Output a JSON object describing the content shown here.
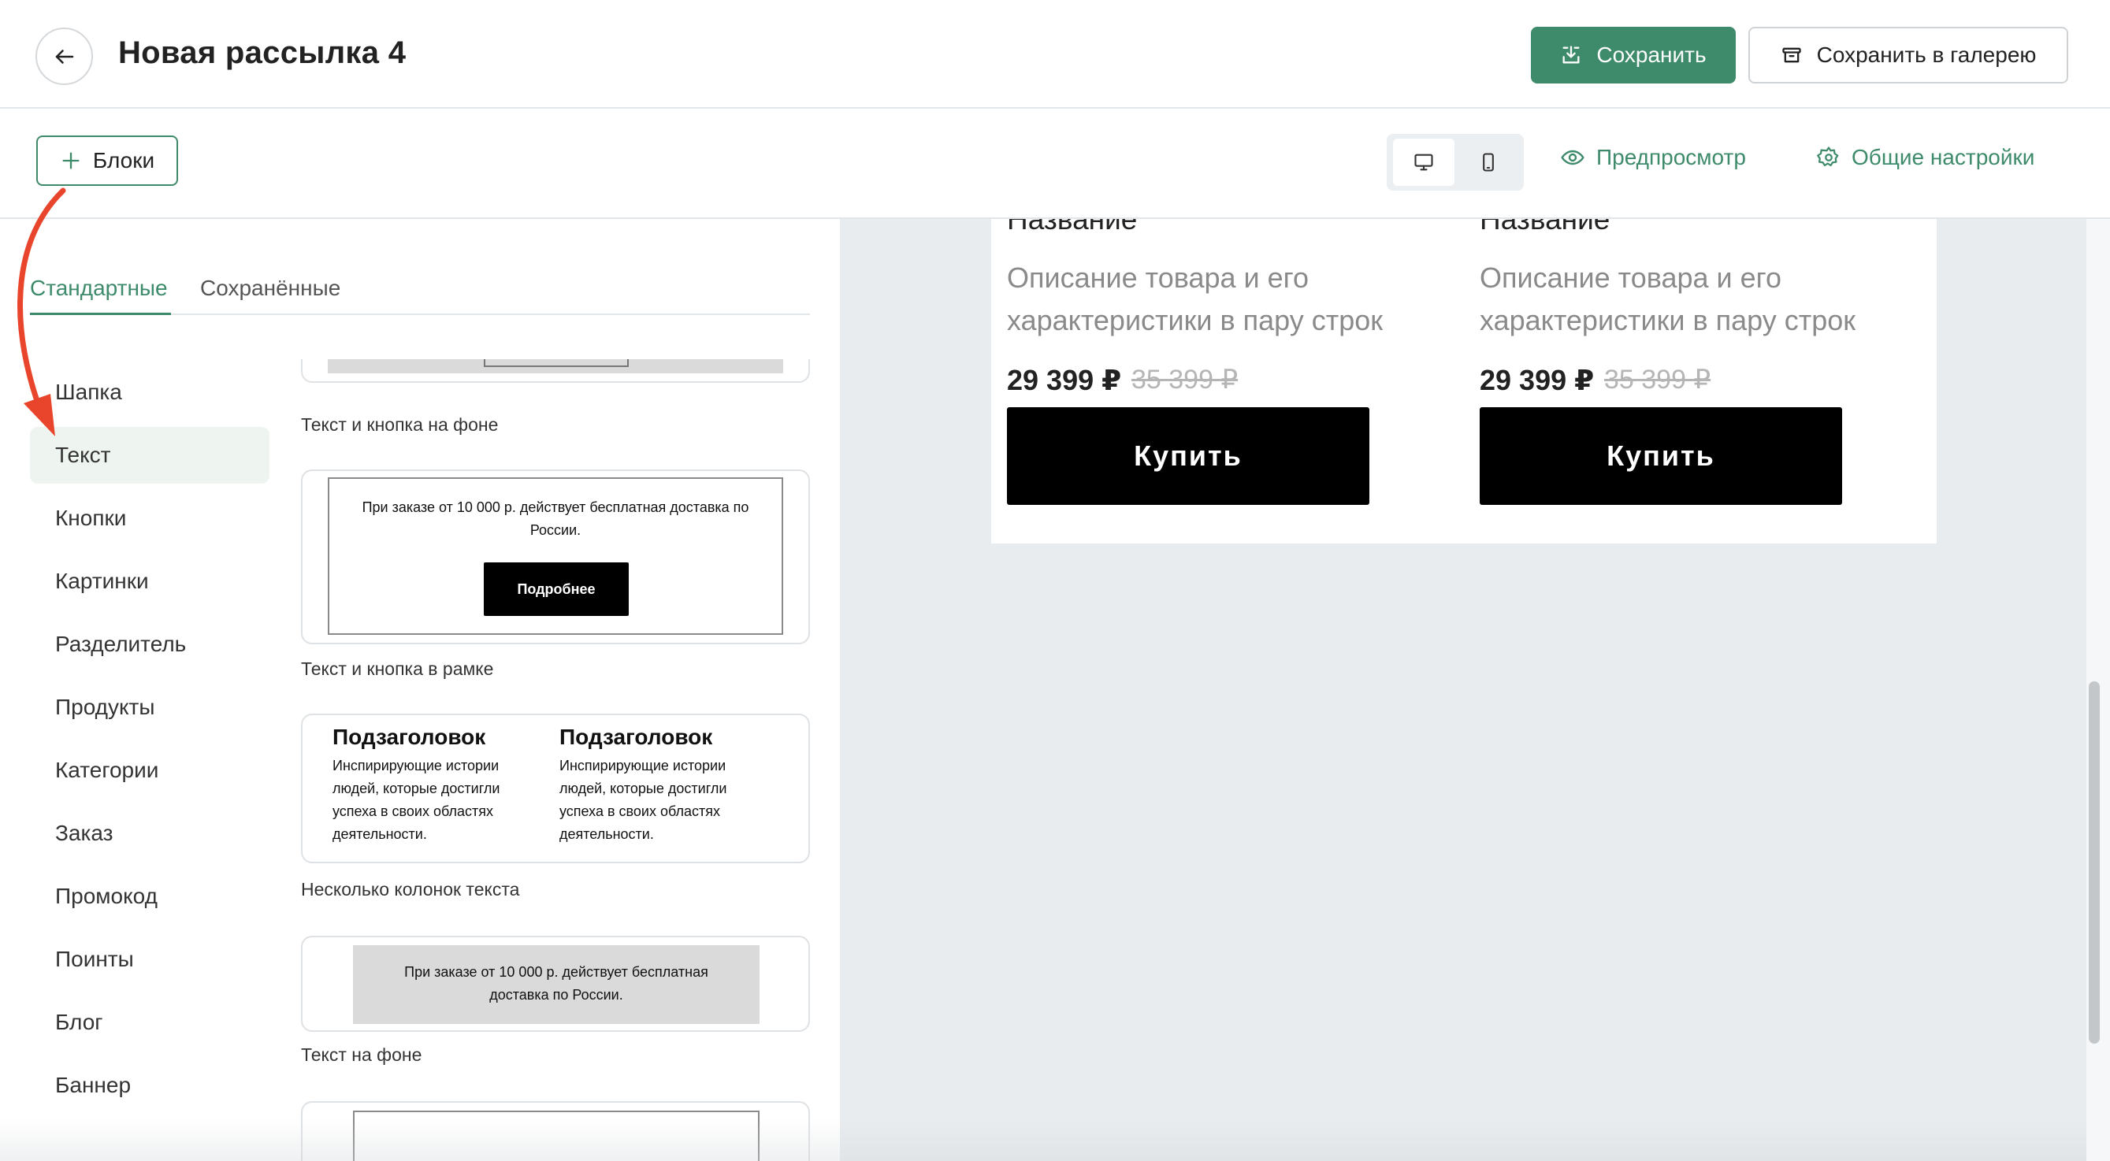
{
  "header": {
    "title": "Новая рассылка 4",
    "save_label": "Сохранить",
    "save_gallery_label": "Сохранить в галерею"
  },
  "toolbar": {
    "blocks_label": "Блоки",
    "preview_label": "Предпросмотр",
    "settings_label": "Общие настройки"
  },
  "tabs": {
    "standard": "Стандартные",
    "saved": "Сохранённые"
  },
  "categories": [
    "Шапка",
    "Текст",
    "Кнопки",
    "Картинки",
    "Разделитель",
    "Продукты",
    "Категории",
    "Заказ",
    "Промокод",
    "Поинты",
    "Блог",
    "Баннер"
  ],
  "active_category": "Текст",
  "blocks": {
    "text_button_bg_caption": "Текст и кнопка на фоне",
    "frame": {
      "text": "При заказе от 10 000 р. действует бесплатная доставка по России.",
      "button": "Подробнее",
      "caption": "Текст и кнопка в рамке"
    },
    "columns": {
      "col1_title": "Подзаголовок",
      "col1_text": "Инспирирующие истории людей, которые достигли успеха в своих областях деятельности.",
      "col2_title": "Подзаголовок",
      "col2_text": "Инспирирующие истории людей, которые достигли успеха в своих областях деятельности.",
      "caption": "Несколько колонок текста"
    },
    "text_bg": {
      "text": "При заказе от 10 000 р. действует бесплатная доставка по России.",
      "caption": "Текст на фоне"
    }
  },
  "products": [
    {
      "name": "Название",
      "description": "Описание товара и его характеристики в пару строк",
      "price": "29 399 ₽",
      "old_price": "35 399 ₽",
      "button": "Купить"
    },
    {
      "name": "Название",
      "description": "Описание товара и его характеристики в пару строк",
      "price": "29 399 ₽",
      "old_price": "35 399 ₽",
      "button": "Купить"
    }
  ],
  "colors": {
    "accent": "#3d8b6a",
    "annotation_arrow": "#e8452c"
  },
  "icons": {
    "back": "arrow-left-icon",
    "save": "download-icon",
    "gallery": "archive-icon",
    "blocks": "plus-icon",
    "desktop": "monitor-icon",
    "mobile": "phone-icon",
    "preview": "eye-icon",
    "settings": "gear-icon"
  }
}
